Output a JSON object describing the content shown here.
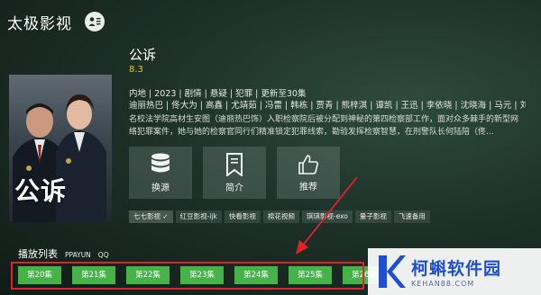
{
  "app": {
    "title": "太极影视"
  },
  "drama": {
    "title": "公诉",
    "rating": "8.3",
    "meta": "内地 | 2023 | 剧情 | 悬疑 | 犯罪 | 更新至30集",
    "cast": "迪丽热巴 | 佟大为 | 高鑫 | 尤靖茹 | 冯雷 | 韩栋 | 贾青 | 熊梓淇 | 谭凯 | 王迅 | 李依晓 | 沈晓海 | 马元 | 刘",
    "description": "名校法学院高材生安图（迪丽热巴饰）入职检察院后被分配到神秘的第四检察部工作，面对众多棘手的新型网络犯罪案件，她与她的检察官同行们精准锁定犯罪线索，勘验发挥检察智慧，在刑警队长何陆陪（佟...",
    "poster_title": "公诉"
  },
  "actions": [
    {
      "label": "换源",
      "icon": "database-icon"
    },
    {
      "label": "简介",
      "icon": "bookmark-icon"
    },
    {
      "label": "推荐",
      "icon": "thumbs-up-icon"
    }
  ],
  "sources": [
    {
      "label": "七七影视 ✓",
      "active": true
    },
    {
      "label": "红豆影视-ijk"
    },
    {
      "label": "快看影视"
    },
    {
      "label": "棉花视频"
    },
    {
      "label": "琪琪影视-exo"
    },
    {
      "label": "量子影视"
    },
    {
      "label": "飞速备用"
    }
  ],
  "playlist": {
    "title": "播放列表",
    "lines": [
      "PPAYUN",
      "QQ"
    ],
    "episodes": [
      "第20集",
      "第21集",
      "第22集",
      "第23集",
      "第24集",
      "第25集",
      "第26集"
    ]
  },
  "watermark": {
    "name": "柯蝌软件园",
    "url": "KEHAN88.COM"
  },
  "colors": {
    "accent_green": "#47b24a",
    "highlight_red": "#e0232a",
    "rating_yellow": "#f1c40f"
  }
}
